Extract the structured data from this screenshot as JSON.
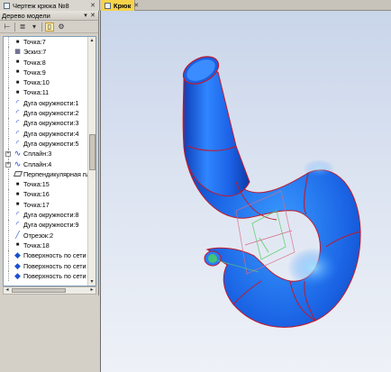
{
  "tabs": [
    {
      "label": "Чертеж крюка №8",
      "active": false
    },
    {
      "label": "Крюк",
      "active": true
    }
  ],
  "panel": {
    "title": "Дерево модели",
    "controls": [
      "▾",
      "✕"
    ]
  },
  "toolbar": {
    "icons": [
      "tree-view-icon",
      "list-view-icon",
      "dropdown-icon",
      "structure-icon",
      "properties-icon"
    ]
  },
  "tree_items": [
    {
      "label": "Точка:7",
      "icon": "point-icon",
      "expandable": false
    },
    {
      "label": "Эскиз:7",
      "icon": "sketch-icon",
      "expandable": false
    },
    {
      "label": "Точка:8",
      "icon": "point-icon",
      "expandable": false
    },
    {
      "label": "Точка:9",
      "icon": "point-icon",
      "expandable": false
    },
    {
      "label": "Точка:10",
      "icon": "point-icon",
      "expandable": false
    },
    {
      "label": "Точка:11",
      "icon": "point-icon",
      "expandable": false
    },
    {
      "label": "Дуга окружности:1",
      "icon": "arc-icon",
      "expandable": false
    },
    {
      "label": "Дуга окружности:2",
      "icon": "arc-icon",
      "expandable": false
    },
    {
      "label": "Дуга окружности:3",
      "icon": "arc-icon",
      "expandable": false
    },
    {
      "label": "Дуга окружности:4",
      "icon": "arc-icon",
      "expandable": false
    },
    {
      "label": "Дуга окружности:5",
      "icon": "arc-icon",
      "expandable": false
    },
    {
      "label": "Сплайн:3",
      "icon": "spline-icon",
      "expandable": true
    },
    {
      "label": "Сплайн:4",
      "icon": "spline-icon",
      "expandable": true
    },
    {
      "label": "Перпендикулярная пл",
      "icon": "plane-icon",
      "expandable": false
    },
    {
      "label": "Точка:15",
      "icon": "point-icon",
      "expandable": false
    },
    {
      "label": "Точка:16",
      "icon": "point-icon",
      "expandable": false
    },
    {
      "label": "Точка:17",
      "icon": "point-icon",
      "expandable": false
    },
    {
      "label": "Дуга окружности:8",
      "icon": "arc-icon",
      "expandable": false
    },
    {
      "label": "Дуга окружности:9",
      "icon": "arc-icon",
      "expandable": false
    },
    {
      "label": "Отрезок:2",
      "icon": "segment-icon",
      "expandable": false
    },
    {
      "label": "Точка:18",
      "icon": "point-icon",
      "expandable": false
    },
    {
      "label": "Поверхность по сети т",
      "icon": "surface-icon",
      "expandable": false
    },
    {
      "label": "Поверхность по сети т",
      "icon": "surface-icon",
      "expandable": false
    },
    {
      "label": "Поверхность по сети т",
      "icon": "surface-icon",
      "expandable": false
    }
  ],
  "colors": {
    "active_tab": "#f7d34a",
    "model_blue": "#1f6ff0",
    "edge_red": "#c2182b",
    "viewport_bg": "#dfe6f2"
  }
}
